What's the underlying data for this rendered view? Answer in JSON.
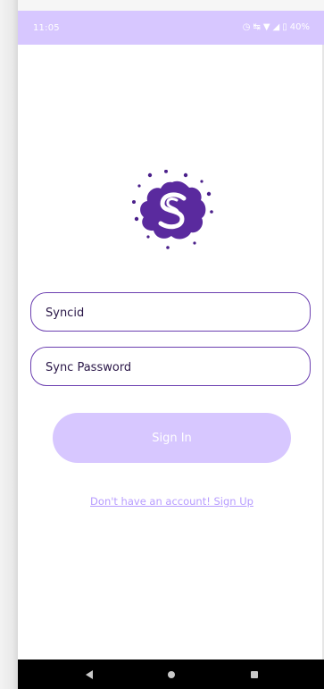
{
  "status_bar": {
    "time": "11:05",
    "battery": "40%",
    "icons": [
      "alarm-icon",
      "vibrate-icon",
      "wifi-icon",
      "signal-icon",
      "battery-icon"
    ]
  },
  "login": {
    "syncid_placeholder": "Syncid",
    "password_placeholder": "Sync Password",
    "signin_label": "Sign In",
    "signup_link": "Don't have an account! Sign Up"
  },
  "colors": {
    "accent": "#6b3fb0",
    "status_bar": "#d7c7ff",
    "button_disabled": "#d7c7ff",
    "link": "#b79cff"
  },
  "nav_bar": {
    "buttons": [
      "back-icon",
      "home-icon",
      "recents-icon"
    ]
  }
}
